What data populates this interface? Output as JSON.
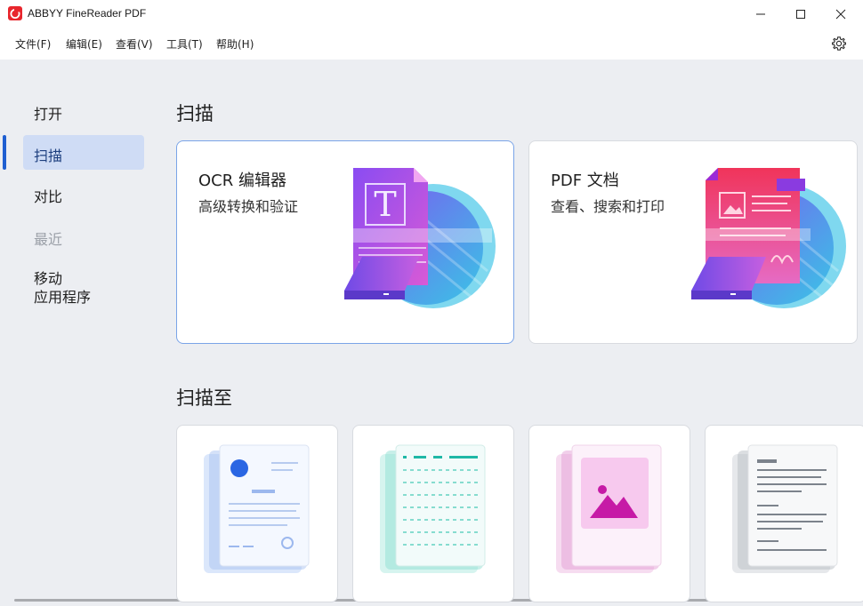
{
  "window": {
    "title": "ABBYY FineReader PDF",
    "minimize_label": "",
    "maximize_label": "",
    "close_label": ""
  },
  "menu": {
    "items": [
      {
        "label": "文件(F)"
      },
      {
        "label": "编辑(E)"
      },
      {
        "label": "查看(V)"
      },
      {
        "label": "工具(T)"
      },
      {
        "label": "帮助(H)"
      }
    ]
  },
  "sidebar": {
    "items": [
      {
        "label": "打开"
      },
      {
        "label": "扫描",
        "selected": true
      },
      {
        "label": "对比"
      },
      {
        "label": "最近",
        "disabled": true
      },
      {
        "label": "移动\n应用程序"
      }
    ]
  },
  "main": {
    "scan_heading": "扫描",
    "cards": [
      {
        "title": "OCR 编辑器",
        "subtitle": "高级转换和验证"
      },
      {
        "title": "PDF 文档",
        "subtitle": "查看、搜索和打印"
      }
    ],
    "scan_to_heading": "扫描至",
    "small_cards": [
      {
        "icon": "document-profile-icon"
      },
      {
        "icon": "spreadsheet-icon"
      },
      {
        "icon": "image-icon"
      },
      {
        "icon": "text-document-icon"
      }
    ]
  },
  "colors": {
    "accent": "#1f5fd1",
    "selected_bg": "#cfdcf5",
    "brand_red": "#e8262d",
    "background": "#eceef2"
  }
}
